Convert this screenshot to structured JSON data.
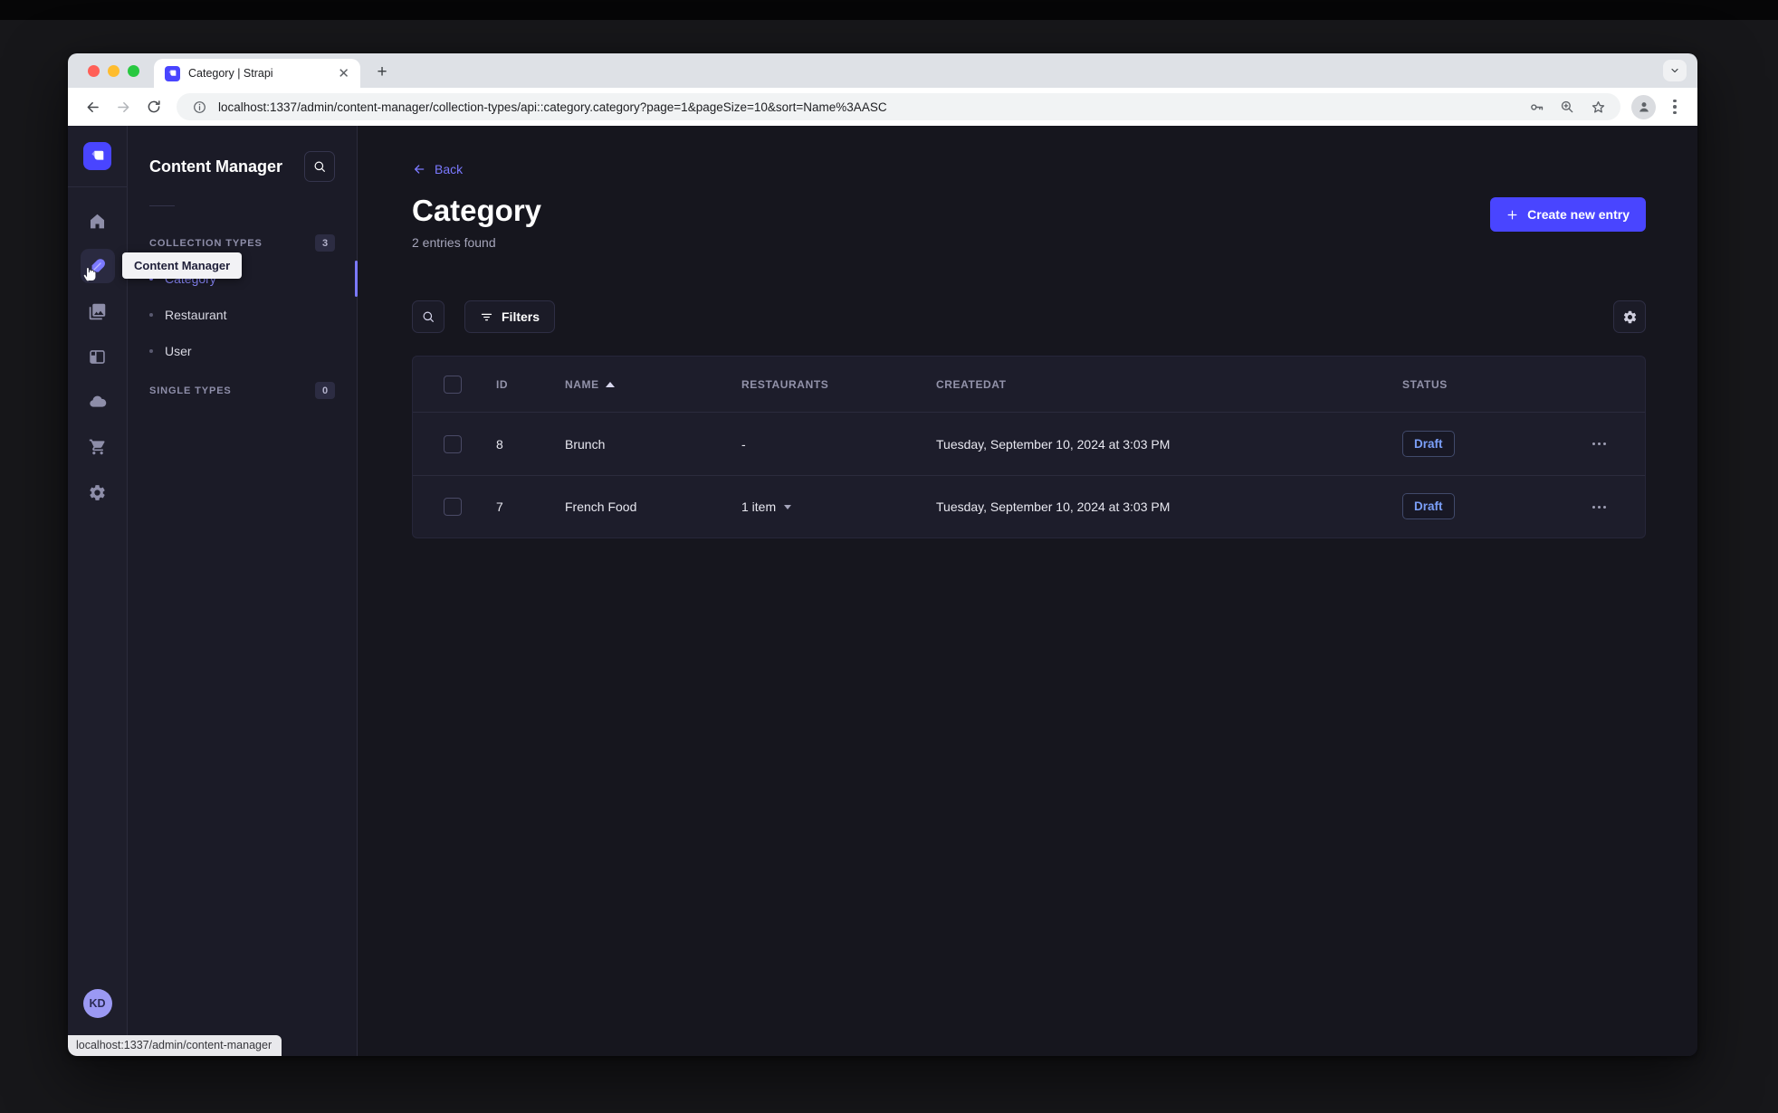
{
  "colors": {
    "accent": "#4945ff",
    "accent_light": "#7b79ff",
    "draft_text": "#7b9ff8",
    "app_background": "#16161e",
    "panel_background": "#1d1d2b",
    "rail_icon": "#8e8ea9"
  },
  "browser": {
    "tab_title": "Category | Strapi",
    "url": "localhost:1337/admin/content-manager/collection-types/api::category.category?page=1&pageSize=10&sort=Name%3AASC",
    "status_bar_url": "localhost:1337/admin/content-manager"
  },
  "sidebar": {
    "tooltip": "Content Manager",
    "avatar_initials": "KD"
  },
  "subnav": {
    "title": "Content Manager",
    "collection_section_label": "COLLECTION TYPES",
    "collection_count": "3",
    "items": [
      {
        "label": "Category",
        "active": true
      },
      {
        "label": "Restaurant",
        "active": false
      },
      {
        "label": "User",
        "active": false
      }
    ],
    "single_section_label": "SINGLE TYPES",
    "single_count": "0"
  },
  "main": {
    "back_label": "Back",
    "title": "Category",
    "subtitle": "2 entries found",
    "create_button_label": "Create new entry",
    "filters_label": "Filters",
    "help_fab_label": "?",
    "table": {
      "columns": [
        "ID",
        "NAME",
        "RESTAURANTS",
        "CREATEDAT",
        "STATUS"
      ],
      "sort": {
        "column": "NAME",
        "direction": "ascending"
      },
      "rows": [
        {
          "id": "8",
          "name": "Brunch",
          "restaurants": "-",
          "created_at": "Tuesday, September 10, 2024 at 3:03 PM",
          "status": "Draft"
        },
        {
          "id": "7",
          "name": "French Food",
          "restaurants": "1 item",
          "created_at": "Tuesday, September 10, 2024 at 3:03 PM",
          "status": "Draft"
        }
      ]
    }
  }
}
